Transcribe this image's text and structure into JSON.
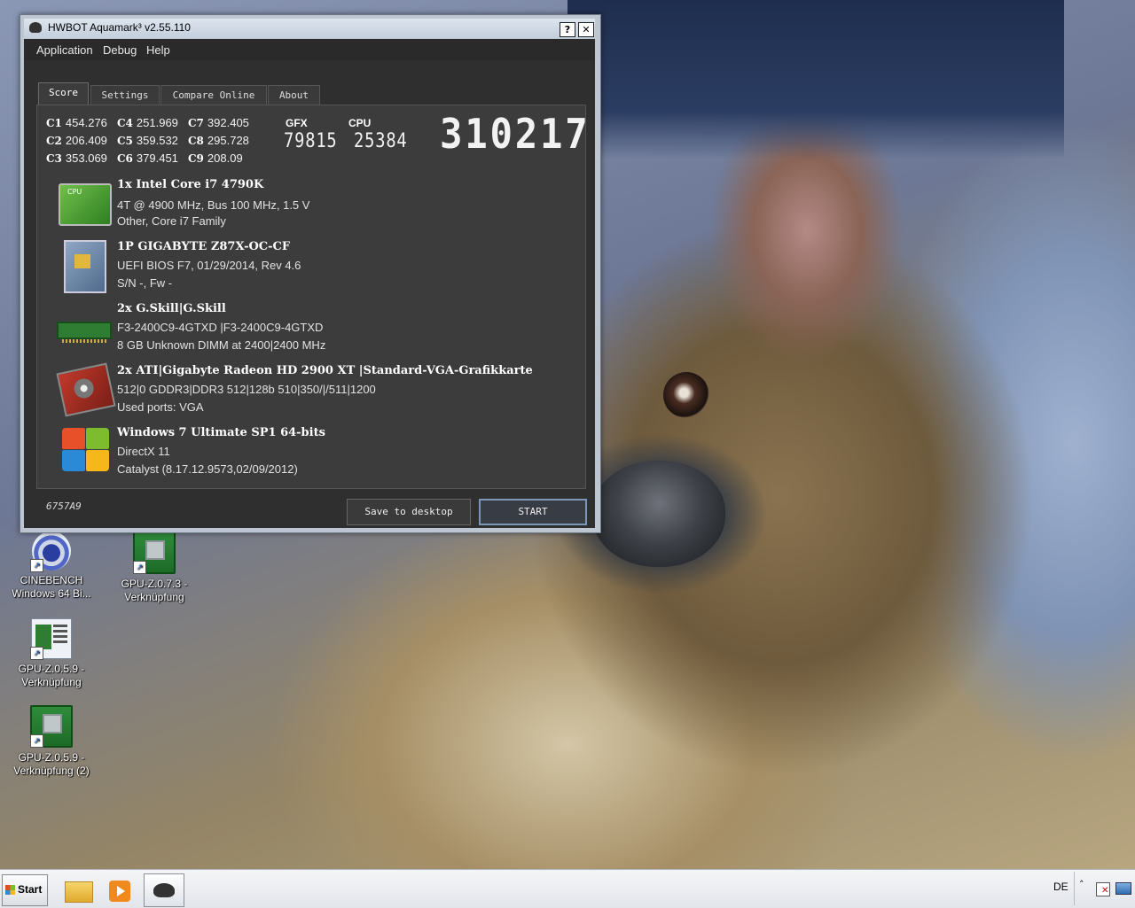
{
  "window": {
    "title": "HWBOT Aquamark³ v2.55.110",
    "help_btn": "?",
    "close_btn": "✕"
  },
  "menu": [
    "Application",
    "Debug",
    "Help"
  ],
  "tabs": [
    "Score",
    "Settings",
    "Compare Online",
    "About"
  ],
  "scores": {
    "c1": {
      "label": "C1",
      "value": "454.276"
    },
    "c2": {
      "label": "C2",
      "value": "206.409"
    },
    "c3": {
      "label": "C3",
      "value": "353.069"
    },
    "c4": {
      "label": "C4",
      "value": "251.969"
    },
    "c5": {
      "label": "C5",
      "value": "359.532"
    },
    "c6": {
      "label": "C6",
      "value": "379.451"
    },
    "c7": {
      "label": "C7",
      "value": "392.405"
    },
    "c8": {
      "label": "C8",
      "value": "295.728"
    },
    "c9": {
      "label": "C9",
      "value": "208.09"
    }
  },
  "gfx": {
    "label": "GFX",
    "value": "79815"
  },
  "cpu": {
    "label": "CPU",
    "value": "25384"
  },
  "total_score": "310217",
  "hardware": {
    "cpu": {
      "title": "1x Intel Core i7 4790K",
      "line1": "4T @ 4900 MHz, Bus 100 MHz, 1.5 V",
      "line2": "Other, Core i7 Family",
      "icon": "cpu-icon"
    },
    "board": {
      "title": "1P GIGABYTE Z87X-OC-CF",
      "line1": "UEFI BIOS F7, 01/29/2014, Rev 4.6",
      "line2": "S/N -, Fw -",
      "icon": "motherboard-icon"
    },
    "memory": {
      "title": "2x G.Skill|G.Skill",
      "line1": " F3-2400C9-4GTXD  |F3-2400C9-4GTXD",
      "line2": "8 GB Unknown DIMM at 2400|2400 MHz",
      "icon": "memory-icon"
    },
    "gpu": {
      "title": "2x ATI|Gigabyte Radeon HD 2900 XT |Standard-VGA-Grafikkarte",
      "line1": "512|0 GDDR3|DDR3 512|128b 510|350/|/511|1200",
      "line2": "Used ports: VGA",
      "icon": "graphics-card-icon"
    },
    "os": {
      "title": "Windows 7 Ultimate SP1 64-bits",
      "line1": "DirectX 11",
      "line2": "Catalyst (8.17.12.9573,02/09/2012)",
      "icon": "windows-logo-icon"
    }
  },
  "build_id": "6757A9",
  "buttons": {
    "save": "Save to desktop",
    "start": "START"
  },
  "desktop_icons": [
    {
      "line1": "CINEBENCH",
      "line2": "Windows 64 Bi...",
      "icon": "cinebench-icon"
    },
    {
      "line1": "GPU-Z.0.7.3 -",
      "line2": "Verknüpfung",
      "icon": "gpuz-icon"
    },
    {
      "line1": "GPU-Z.0.5.9 -",
      "line2": "Verknüpfung",
      "icon": "gpuz-old-icon"
    },
    {
      "line1": "GPU-Z.0.5.9 -",
      "line2": "Verknüpfung (2)",
      "icon": "gpuz-icon"
    }
  ],
  "taskbar": {
    "start_label": "Start",
    "language": "DE",
    "tray_arrow": "˄"
  },
  "colors": {
    "window_bg": "#2f2f2f",
    "panel_bg": "#3c3c3c",
    "start_button_border": "#7a96b8"
  }
}
